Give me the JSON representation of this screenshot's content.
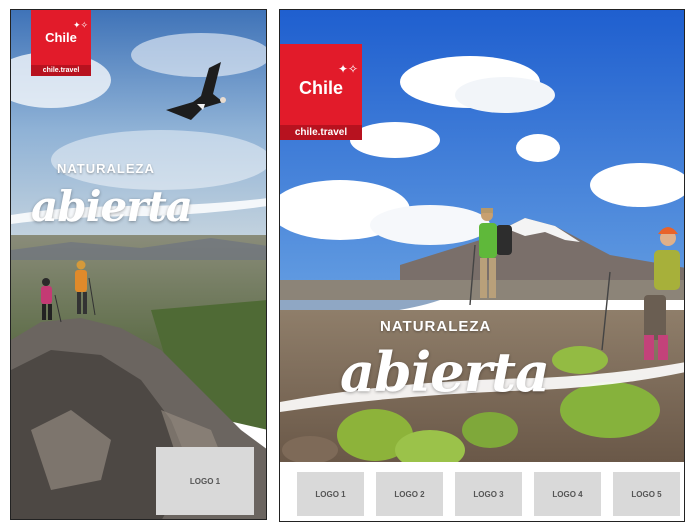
{
  "left_ad": {
    "brand": {
      "name": "Chile",
      "url": "chile.travel"
    },
    "tagline": "NATURALEZA",
    "script_word": "abierta",
    "logos": [
      "LOGO 1"
    ]
  },
  "right_ad": {
    "brand": {
      "name": "Chile",
      "url": "chile.travel"
    },
    "tagline": "NATURALEZA",
    "script_word": "abierta",
    "logos": [
      "LOGO 1",
      "LOGO 2",
      "LOGO 3",
      "LOGO 4",
      "LOGO 5"
    ]
  },
  "colors": {
    "brand_red": "#e21b2a",
    "sky_blue": "#2f6fd0",
    "logo_placeholder": "#d9d9d9"
  }
}
